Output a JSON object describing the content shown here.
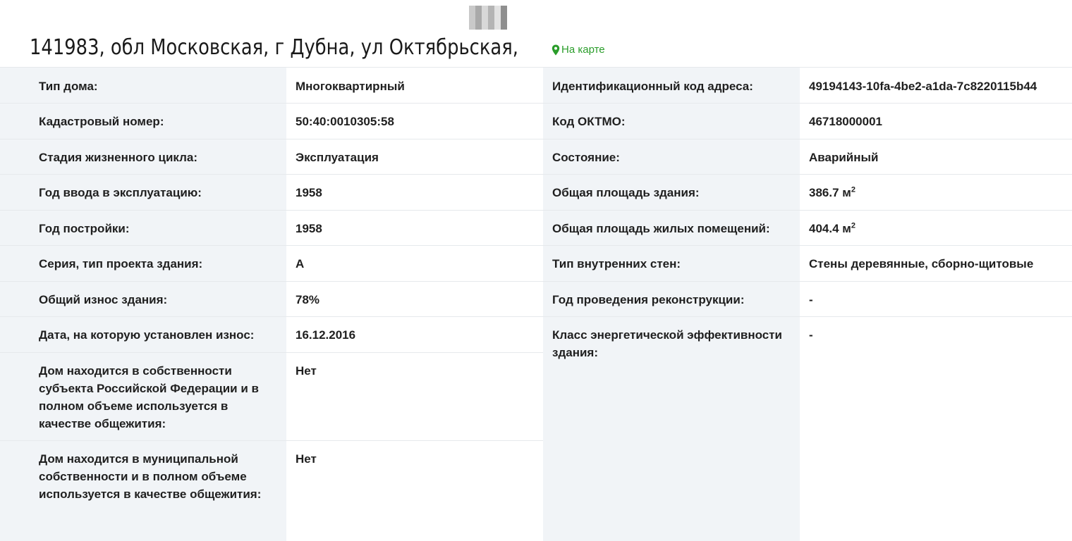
{
  "header": {
    "address": "141983, обл Московская, г Дубна, ул Октябрьская,",
    "map_link": "На карте"
  },
  "left_rows": [
    {
      "label": "Тип дома:",
      "value": "Многоквартирный"
    },
    {
      "label": "Кадастровый номер:",
      "value": "50:40:0010305:58"
    },
    {
      "label": "Стадия жизненного цикла:",
      "value": "Эксплуатация"
    },
    {
      "label": "Год ввода в эксплуатацию:",
      "value": "1958"
    },
    {
      "label": "Год постройки:",
      "value": "1958"
    },
    {
      "label": "Серия, тип проекта здания:",
      "value": "А"
    },
    {
      "label": "Общий износ здания:",
      "value": "78%"
    },
    {
      "label": "Дата, на которую установлен износ:",
      "value": "16.12.2016"
    },
    {
      "label": "Дом находится в собственности субъекта Российской Федерации и в полном объеме используется в качестве общежития:",
      "value": "Нет"
    },
    {
      "label": "Дом находится в муниципальной собственности и в полном объеме используется в качестве общежития:",
      "value": "Нет"
    }
  ],
  "right_rows": [
    {
      "label": "Идентификационный код адреса:",
      "value": "49194143-10fa-4be2-a1da-7c8220115b44"
    },
    {
      "label": "Код ОКТМО:",
      "value": "46718000001"
    },
    {
      "label": "Состояние:",
      "value": "Аварийный"
    },
    {
      "label": "Общая площадь здания:",
      "value": "386.7 м",
      "unit_sup": "2"
    },
    {
      "label": "Общая площадь жилых помещений:",
      "value": "404.4 м",
      "unit_sup": "2"
    },
    {
      "label": "Тип внутренних стен:",
      "value": "Стены деревянные, сборно-щитовые"
    },
    {
      "label": "Год проведения реконструкции:",
      "value": "-"
    },
    {
      "label": "Класс энергетической эффективности здания:",
      "value": "-"
    }
  ],
  "colors": {
    "label_bg": "#f1f4f7",
    "map_link": "#2a9d2a"
  }
}
